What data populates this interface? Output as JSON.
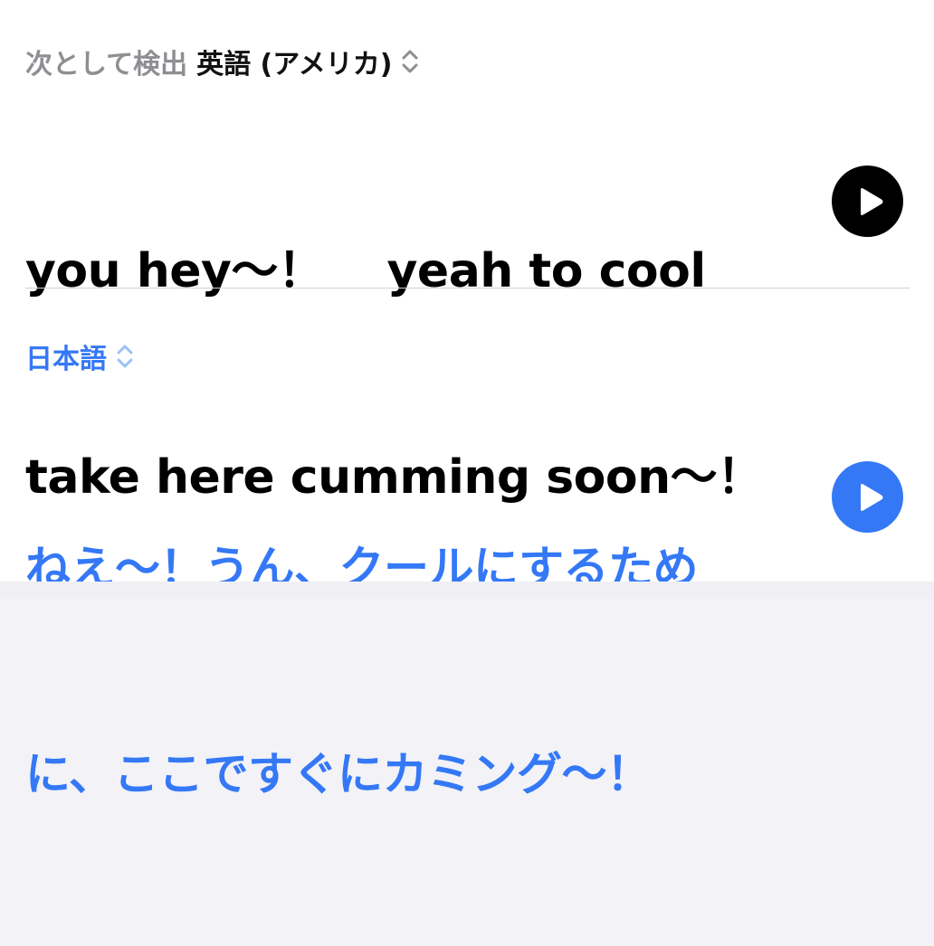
{
  "source": {
    "detected_prefix": "次として検出",
    "language": "英語 (アメリカ)",
    "line1": "you hey～！　 yeah to cool",
    "line2": "take here cumming soon～！"
  },
  "target": {
    "language": "日本語",
    "line1": "ねえ～！うん、クールにするため",
    "line2": "に、ここですぐにカミング～！"
  },
  "icons": {
    "source_chevron": "chevron-up-down-icon",
    "target_chevron": "chevron-up-down-icon",
    "play": "play-icon"
  },
  "colors": {
    "accent": "#3478f6",
    "primary_text": "#000000",
    "secondary_text": "#8e8e93",
    "divider": "#d1d1d6"
  }
}
